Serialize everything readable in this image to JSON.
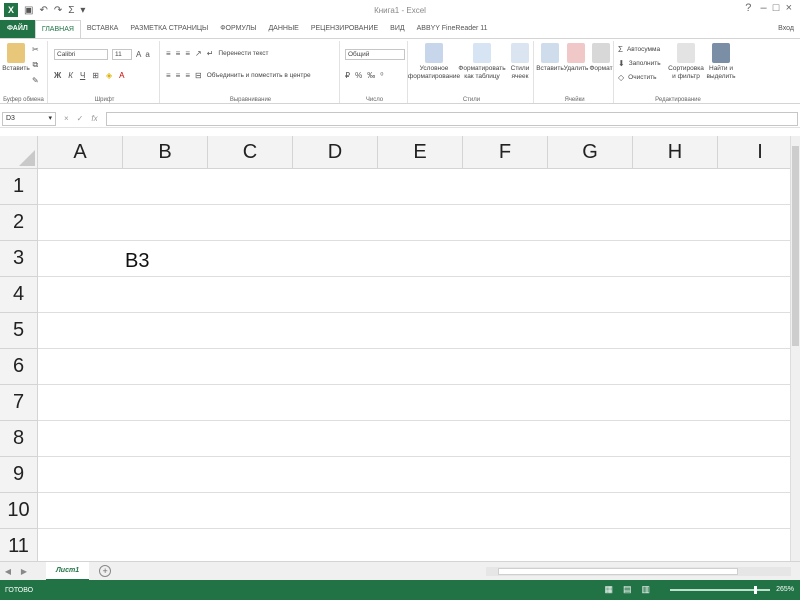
{
  "window": {
    "title": "Книга1 - Excel",
    "signin": "Вход",
    "qat_icons": [
      "excel-logo",
      "save-icon",
      "undo-icon",
      "redo-icon",
      "sum-icon"
    ]
  },
  "tabs": [
    {
      "label": "ФАЙЛ",
      "file": true
    },
    {
      "label": "ГЛАВНАЯ",
      "active": true
    },
    {
      "label": "ВСТАВКА"
    },
    {
      "label": "РАЗМЕТКА СТРАНИЦЫ"
    },
    {
      "label": "ФОРМУЛЫ"
    },
    {
      "label": "ДАННЫЕ"
    },
    {
      "label": "РЕЦЕНЗИРОВАНИЕ"
    },
    {
      "label": "ВИД"
    },
    {
      "label": "ABBYY FineReader 11"
    }
  ],
  "ribbon": {
    "clipboard": {
      "paste": "Вставить",
      "label": "Буфер обмена"
    },
    "font": {
      "name": "Calibri",
      "size": "11",
      "label": "Шрифт",
      "bold": "Ж",
      "italic": "К",
      "underline": "Ч"
    },
    "alignment": {
      "wrap": "Перенести текст",
      "merge": "Объединить и поместить в центре",
      "label": "Выравнивание"
    },
    "number": {
      "format": "Общий",
      "label": "Число"
    },
    "styles": {
      "conditional": "Условное форматирование",
      "as_table": "Форматировать как таблицу",
      "cell_styles": "Стили ячеек",
      "label": "Стили"
    },
    "cells": {
      "insert": "Вставить",
      "delete": "Удалить",
      "format": "Формат",
      "label": "Ячейки"
    },
    "editing": {
      "autosum": "Автосумма",
      "fill": "Заполнить",
      "clear": "Очистить",
      "sort": "Сортировка и фильтр",
      "find": "Найти и выделить",
      "label": "Редактирование"
    }
  },
  "formula_bar": {
    "name_box": "D3",
    "cancel": "×",
    "enter": "✓",
    "fx": "fx",
    "value": ""
  },
  "grid": {
    "columns": [
      "A",
      "B",
      "C",
      "D",
      "E",
      "F",
      "G",
      "H",
      "I"
    ],
    "rows": [
      "1",
      "2",
      "3",
      "4",
      "5",
      "6",
      "7",
      "8",
      "9",
      "10",
      "11"
    ],
    "cell_b3": "B3"
  },
  "sheets": {
    "active": "Лист1",
    "add": "+"
  },
  "status": {
    "text": "ГОТОВО",
    "zoom": "265%"
  },
  "colors": {
    "accent": "#217346"
  }
}
